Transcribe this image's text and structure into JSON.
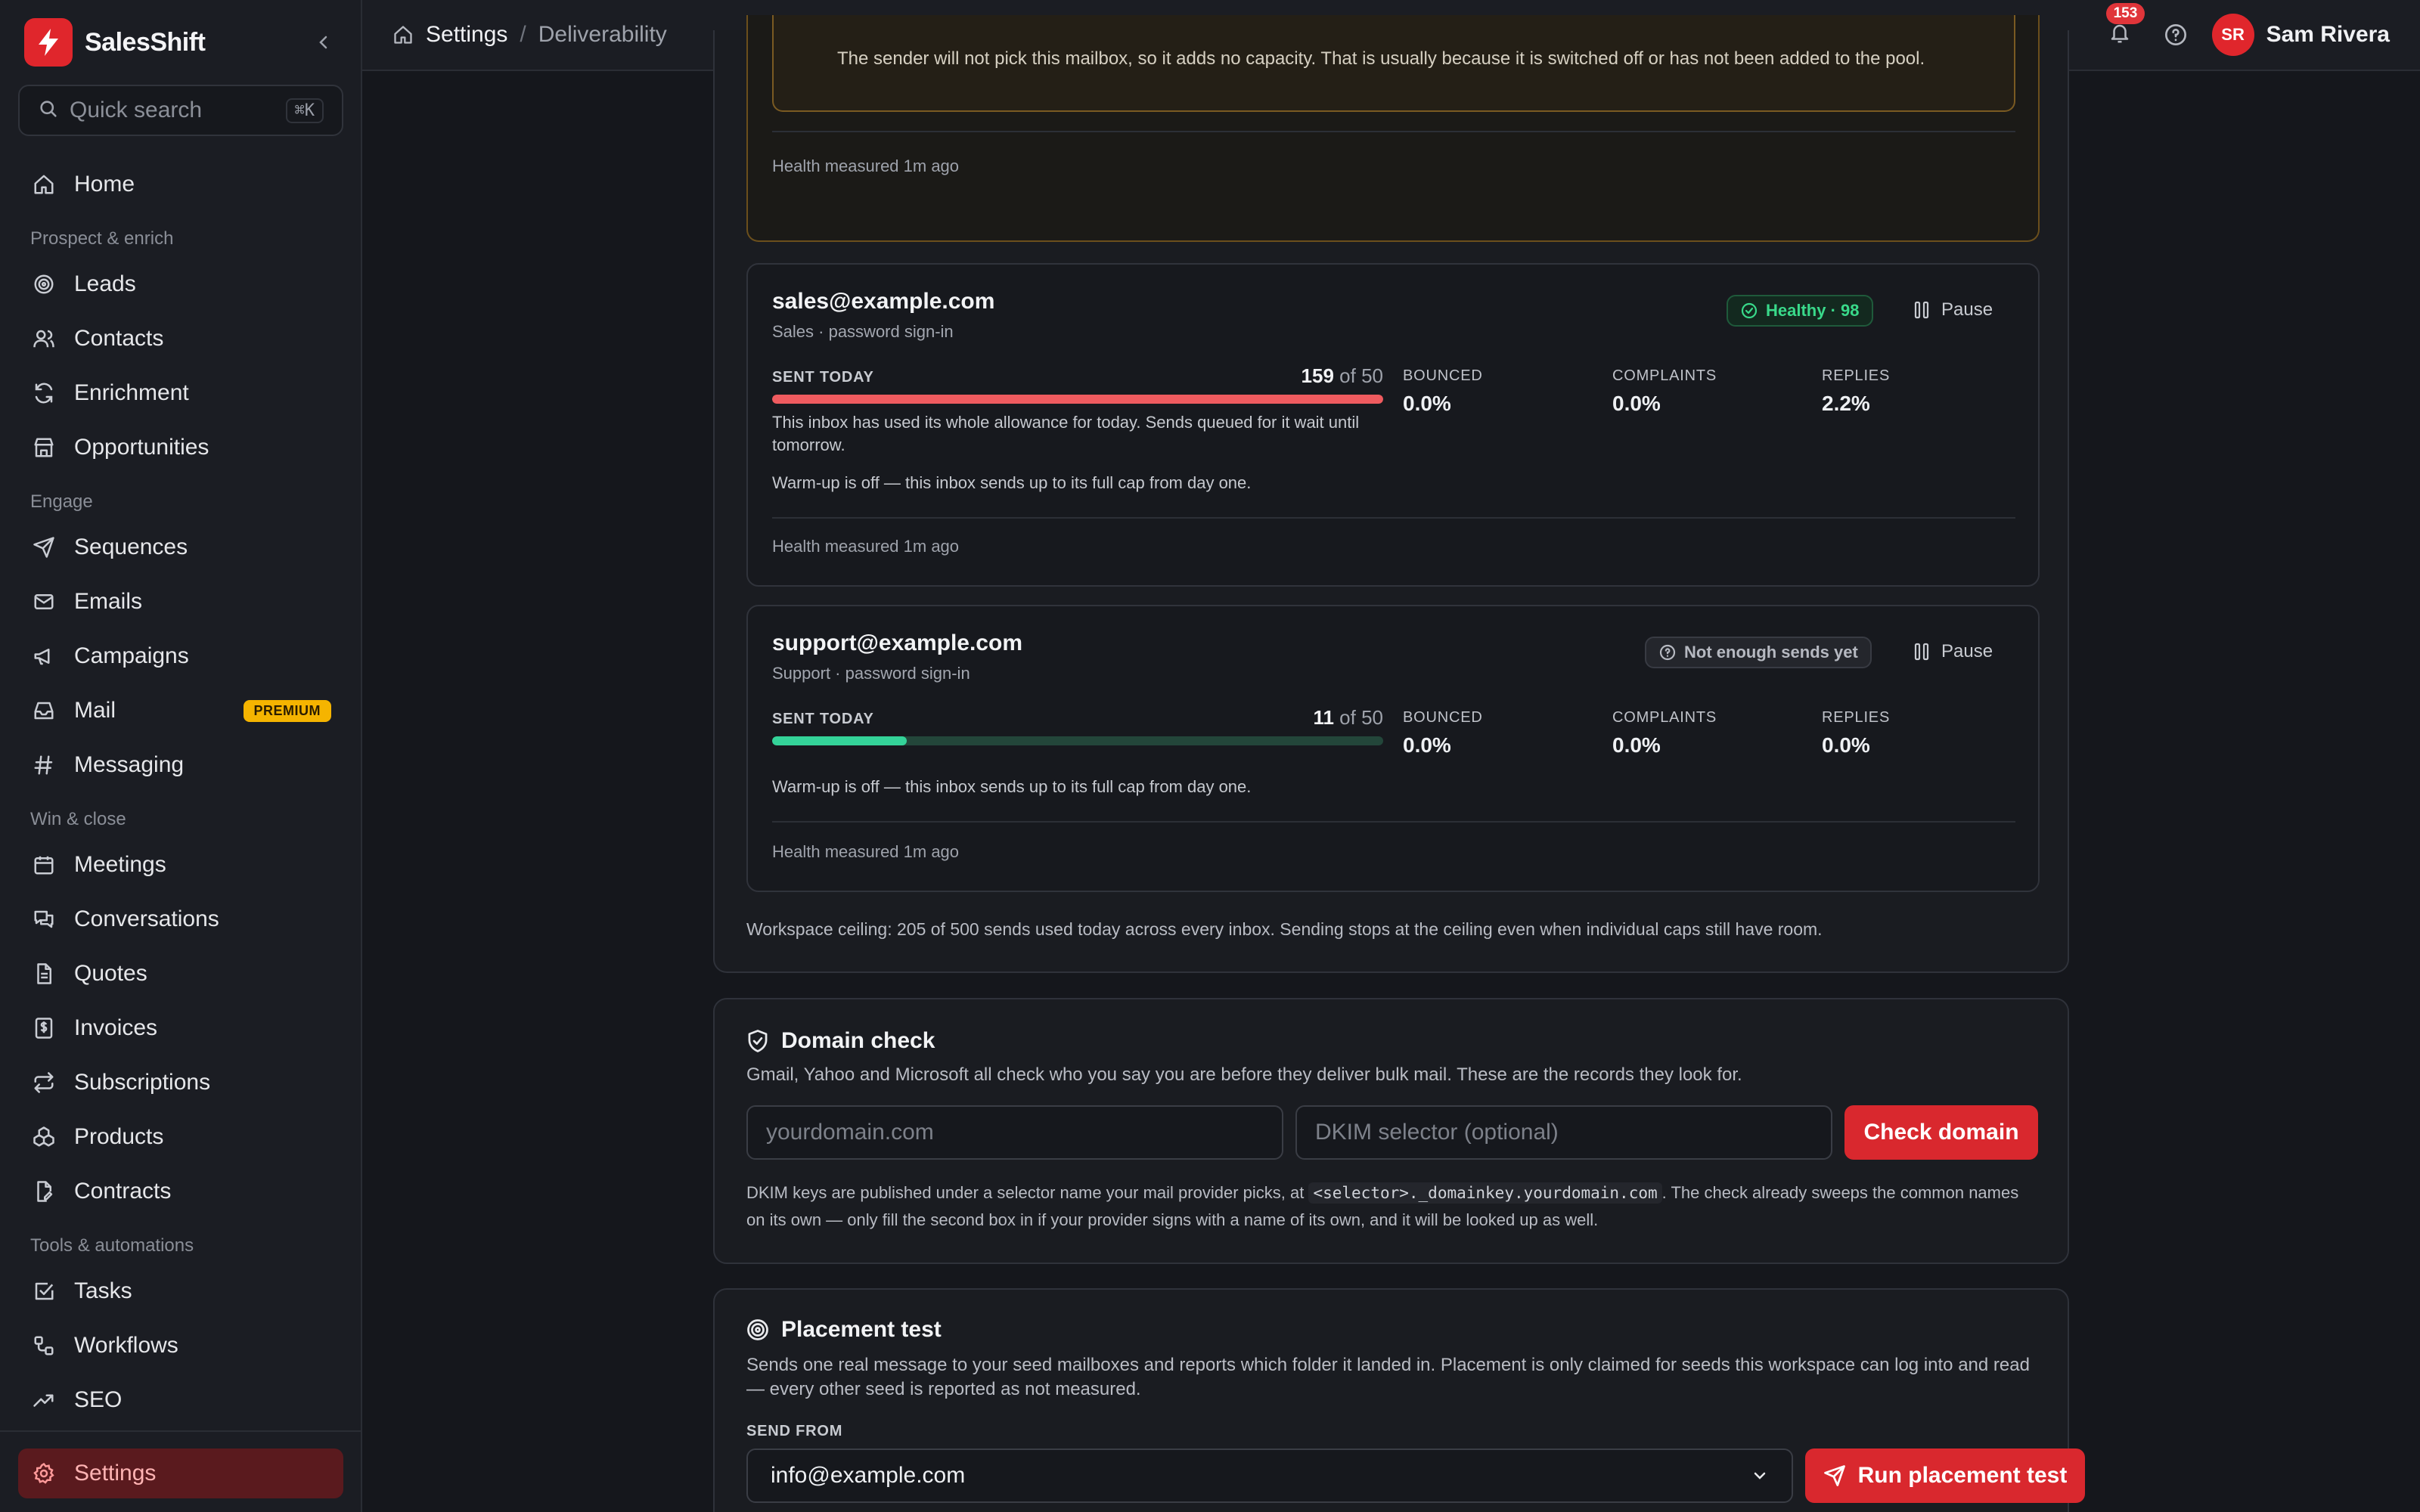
{
  "app": {
    "name": "SalesShift"
  },
  "search": {
    "placeholder": "Quick search",
    "shortcut": "⌘K"
  },
  "nav": {
    "home": "Home",
    "section_prospect": "Prospect & enrich",
    "leads": "Leads",
    "contacts": "Contacts",
    "enrichment": "Enrichment",
    "opportunities": "Opportunities",
    "section_engage": "Engage",
    "sequences": "Sequences",
    "emails": "Emails",
    "campaigns": "Campaigns",
    "mail": "Mail",
    "mail_badge": "PREMIUM",
    "messaging": "Messaging",
    "section_win": "Win & close",
    "meetings": "Meetings",
    "conversations": "Conversations",
    "quotes": "Quotes",
    "invoices": "Invoices",
    "subscriptions": "Subscriptions",
    "products": "Products",
    "contracts": "Contracts",
    "section_tools": "Tools & automations",
    "tasks": "Tasks",
    "workflows": "Workflows",
    "seo": "SEO",
    "settings": "Settings"
  },
  "header": {
    "crumb_settings": "Settings",
    "crumb_sep": "/",
    "crumb_current": "Deliverability",
    "notifications_count": "153",
    "user_initials": "SR",
    "user_name": "Sam Rivera"
  },
  "mailboxes": {
    "top_warning": "The sender will not pick this mailbox, so it adds no capacity. That is usually because it is switched off or has not been added to the pool.",
    "top_health": "Health measured 1m ago",
    "items": [
      {
        "email": "sales@example.com",
        "sub": "Sales · password sign-in",
        "status": "Healthy · 98",
        "pause": "Pause",
        "sent_label": "SENT TODAY",
        "sent": "159",
        "of": "of 50",
        "sent_fraction": 1.0,
        "bar_color": "#ef5b5f",
        "note": "This inbox has used its whole allowance for today. Sends queued for it wait until tomorrow.",
        "warmup": "Warm-up is off — this inbox sends up to its full cap from day one.",
        "bounced_label": "BOUNCED",
        "bounced": "0.0%",
        "complaints_label": "COMPLAINTS",
        "complaints": "0.0%",
        "replies_label": "REPLIES",
        "replies": "2.2%",
        "health": "Health measured 1m ago"
      },
      {
        "email": "support@example.com",
        "sub": "Support · password sign-in",
        "status": "Not enough sends yet",
        "pause": "Pause",
        "sent_label": "SENT TODAY",
        "sent": "11",
        "of": "of 50",
        "sent_fraction": 0.22,
        "bar_color": "#34d399",
        "warmup": "Warm-up is off — this inbox sends up to its full cap from day one.",
        "bounced_label": "BOUNCED",
        "bounced": "0.0%",
        "complaints_label": "COMPLAINTS",
        "complaints": "0.0%",
        "replies_label": "REPLIES",
        "replies": "0.0%",
        "health": "Health measured 1m ago"
      }
    ],
    "ceiling": "Workspace ceiling: 205 of 500 sends used today across every inbox. Sending stops at the ceiling even when individual caps still have room."
  },
  "domain_check": {
    "title": "Domain check",
    "desc": "Gmail, Yahoo and Microsoft all check who you say you are before they deliver bulk mail. These are the records they look for.",
    "domain_placeholder": "yourdomain.com",
    "selector_placeholder": "DKIM selector (optional)",
    "button": "Check domain",
    "help_a": "DKIM keys are published under a selector name your mail provider picks, at",
    "help_code": "<selector>._domainkey.yourdomain.com",
    "help_b": ". The check already sweeps the common names on its own — only fill the second box in if your provider signs with a name of its own, and it will be looked up as well."
  },
  "placement": {
    "title": "Placement test",
    "desc": "Sends one real message to your seed mailboxes and reports which folder it landed in. Placement is only claimed for seeds this workspace can log into and read — every other seed is reported as not measured.",
    "send_from_label": "SEND FROM",
    "send_from_value": "info@example.com",
    "button": "Run placement test"
  }
}
